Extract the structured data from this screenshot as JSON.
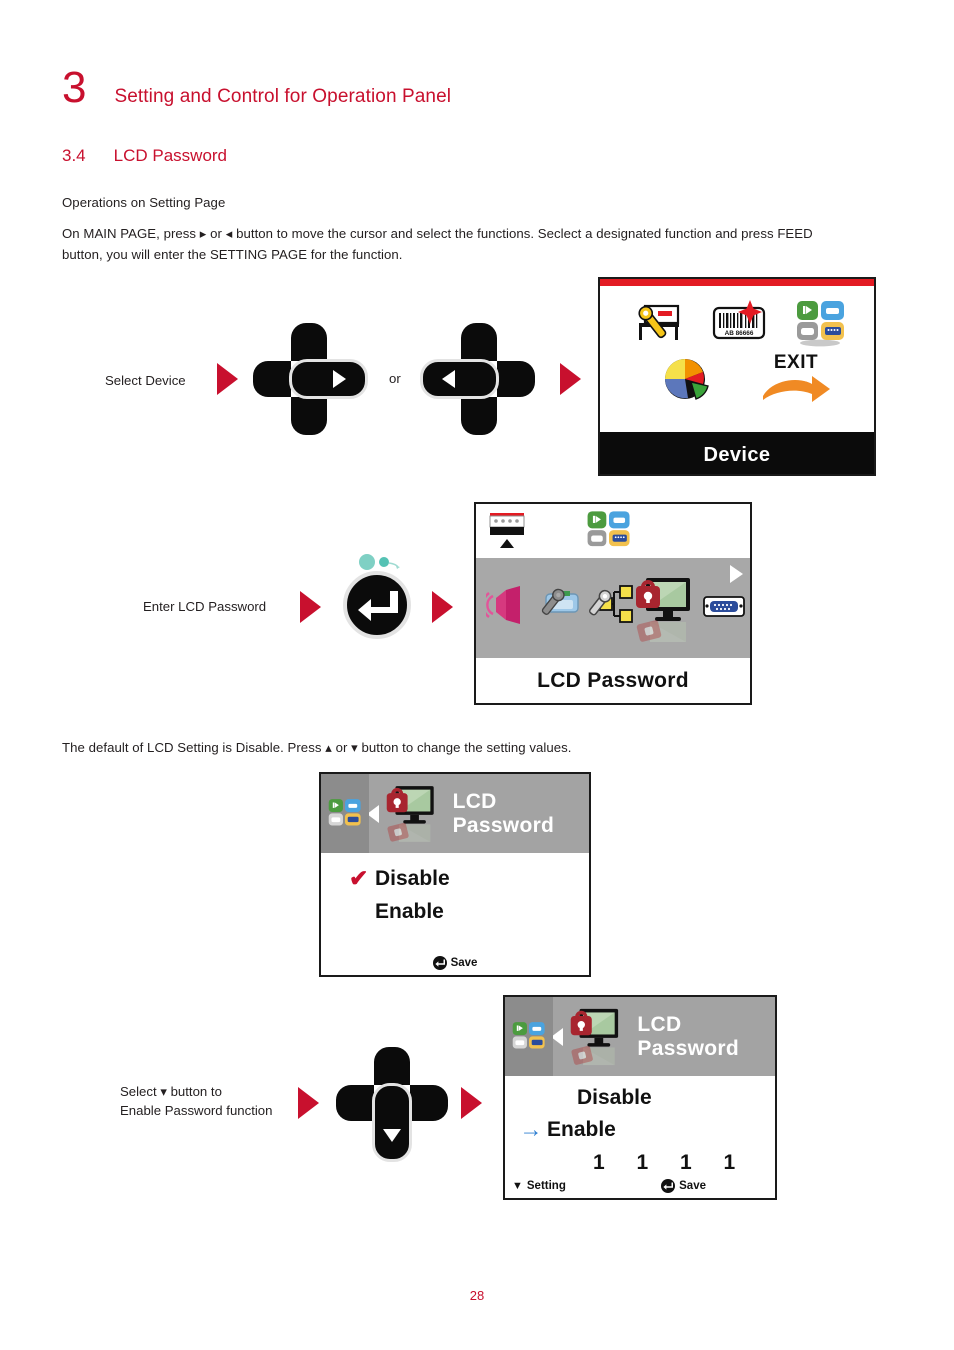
{
  "chapter": {
    "number": "3",
    "title": "Setting and Control for Operation Panel"
  },
  "section": {
    "number": "3.4",
    "title": "LCD Password"
  },
  "paragraphs": {
    "ops_heading": "Operations on Setting Page",
    "main_page": "On MAIN PAGE, press ▸ or ◂ button to move the cursor and select the functions. Seclect a designated function and press FEED button, you will enter the SETTING PAGE for the function.",
    "default_setting": "The default of LCD Setting is Disable. Press ▴ or ▾ button to change the setting values."
  },
  "steps": [
    {
      "id": "select-device",
      "label": "Select Device",
      "or_text": "or",
      "button_left": "right-arrow-dpad",
      "button_right": "left-arrow-dpad"
    },
    {
      "id": "enter-lcd-password",
      "label": "Enter LCD Password",
      "button": "feed-enter-button"
    },
    {
      "id": "select-enable",
      "label_line1": "Select ▾ button to",
      "label_line2": "Enable Password function",
      "button": "down-arrow-dpad"
    }
  ],
  "screens": {
    "device": {
      "title": "Device",
      "icons": [
        {
          "name": "printer-settings-icon",
          "label": ""
        },
        {
          "name": "barcode-label-icon",
          "label": "AB 86666"
        },
        {
          "name": "interface-tiles-icon",
          "label": ""
        },
        {
          "name": "pie-chart-icon",
          "label": ""
        },
        {
          "name": "exit-icon",
          "label": "EXIT"
        }
      ]
    },
    "lcd_password_menu": {
      "title": "LCD Password",
      "top_icons": [
        {
          "name": "paper-feed-icon"
        },
        {
          "name": "interface-tiles-icon"
        }
      ],
      "row_icons": [
        {
          "name": "buzzer-speaker-icon"
        },
        {
          "name": "printer-wrench-icon"
        },
        {
          "name": "network-settings-icon"
        },
        {
          "name": "lcd-password-lock-icon"
        },
        {
          "name": "serial-port-icon"
        }
      ],
      "nav_right": "▶"
    },
    "lcd_password_disable": {
      "header_title": "LCD Password",
      "header_icon": "lcd-password-lock-icon",
      "left_icon": "interface-tiles-icon",
      "nav_left": "◀",
      "options": [
        {
          "label": "Disable",
          "selected": true,
          "marker": "✔"
        },
        {
          "label": "Enable",
          "selected": false,
          "marker": ""
        }
      ],
      "footer": {
        "save_label": "Save",
        "setting_label": ""
      }
    },
    "lcd_password_enable": {
      "header_title": "LCD Password",
      "header_icon": "lcd-password-lock-icon",
      "left_icon": "interface-tiles-icon",
      "nav_left": "◀",
      "options": [
        {
          "label": "Disable",
          "selected": false,
          "marker": ""
        },
        {
          "label": "Enable",
          "selected": true,
          "marker": "→"
        }
      ],
      "password_digits": "1 1 1 1",
      "footer": {
        "setting_label": "Setting",
        "setting_marker": "▼",
        "save_label": "Save"
      }
    }
  },
  "colors": {
    "brand_red": "#c8102e",
    "lcd_red_bar": "#e31b23",
    "lcd_gray": "#a3a3a3",
    "lcd_black": "#0b0b0b"
  },
  "page_number": "28"
}
